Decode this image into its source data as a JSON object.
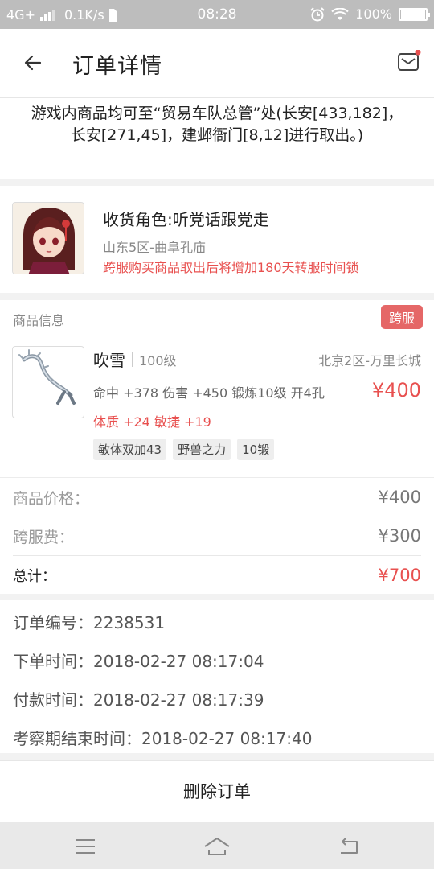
{
  "status": {
    "network": "4G+",
    "speed": "0.1K/s",
    "time": "08:28",
    "battery": "100%"
  },
  "header": {
    "title": "订单详情",
    "back_icon": "arrow-left-icon",
    "message_icon": "mail-icon"
  },
  "notice": {
    "text": "游戏内商品均可至“贸易车队总管”处(长安[433,182]，长安[271,45]，建邺衙门[8,12]进行取出。)"
  },
  "receiver": {
    "name": "收货角色:听党话跟党走",
    "server": "山东5区-曲阜孔庙",
    "warning": "跨服购买商品取出后将增加180天转服时间锁"
  },
  "goods": {
    "section_title": "商品信息",
    "badge": "跨服",
    "item": {
      "name": "吹雪",
      "level": "100级",
      "server": "北京2区-万里长城",
      "attributes": "命中 +378 伤害 +450 锻炼10级 开4孔",
      "bonus": "体质 +24 敏捷 +19",
      "price": "¥400",
      "tags": [
        "敏体双加43",
        "野兽之力",
        "10锻"
      ]
    }
  },
  "prices": {
    "goods_price_label": "商品价格：",
    "goods_price": "¥400",
    "cross_fee_label": "跨服费：",
    "cross_fee": "¥300",
    "total_label": "总计：",
    "total": "¥700"
  },
  "order": {
    "number_label": "订单编号：",
    "number": "2238531",
    "created_label": "下单时间：",
    "created": "2018-02-27 08:17:04",
    "paid_label": "付款时间：",
    "paid": "2018-02-27 08:17:39",
    "review_label": "考察期结束时间：",
    "review_end": "2018-02-27 08:17:40"
  },
  "actions": {
    "delete_label": "删除订单"
  },
  "colors": {
    "accent_red": "#e8504f",
    "badge_red": "#e56767"
  }
}
